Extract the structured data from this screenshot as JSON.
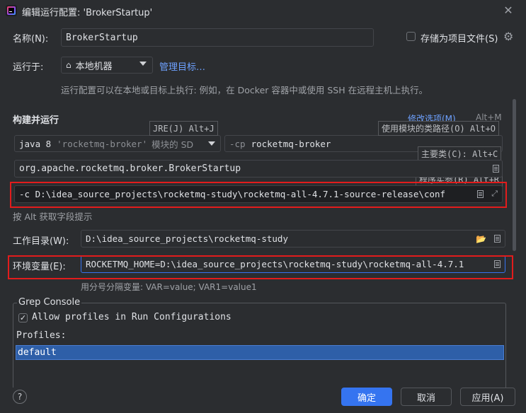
{
  "title": "编辑运行配置: 'BrokerStartup'",
  "name_label": "名称(N):",
  "name_value": "BrokerStartup",
  "store_as_project_file": "存储为项目文件(S)",
  "run_on_label": "运行于:",
  "run_on_value": "本地机器",
  "manage_targets": "管理目标…",
  "run_hint": "运行配置可以在本地或目标上执行: 例如，在 Docker 容器中或使用 SSH 在远程主机上执行。",
  "build_run_header": "构建并运行",
  "modify_options": "修改选项(M)",
  "modify_options_shortcut": "Alt+M",
  "jre": {
    "prefix": "java 8",
    "module": "'rocketmq-broker'",
    "suffix": "模块的 SD"
  },
  "tooltips": {
    "jre": "JRE(J) Alt+J",
    "classpath": "使用模块的类路径(O) Alt+O",
    "main_class": "主要类(C): Alt+C",
    "program_args": "程序实参(R) Alt+R"
  },
  "classpath": {
    "flag": "-cp",
    "value": "rocketmq-broker"
  },
  "main_class_value": "org.apache.rocketmq.broker.BrokerStartup",
  "program_args_value": "-c D:\\idea_source_projects\\rocketmq-study\\rocketmq-all-4.7.1-source-release\\conf",
  "field_hint": "按 Alt 获取字段提示",
  "workdir_label": "工作目录(W):",
  "workdir_value": "D:\\idea_source_projects\\rocketmq-study",
  "env_label": "环境变量(E):",
  "env_value": "ROCKETMQ_HOME=D:\\idea_source_projects\\rocketmq-study\\rocketmq-all-4.7.1",
  "env_hint": "用分号分隔变量: VAR=value; VAR1=value1",
  "grep_console": "Grep Console",
  "allow_profiles": "Allow profiles in Run Configurations",
  "profiles_label": "Profiles:",
  "profiles": [
    "default"
  ],
  "buttons": {
    "ok": "确定",
    "cancel": "取消",
    "apply": "应用(A)"
  },
  "colors": {
    "accent": "#3574f0",
    "highlight": "#e21c1c",
    "selection": "#2e5fa8"
  }
}
